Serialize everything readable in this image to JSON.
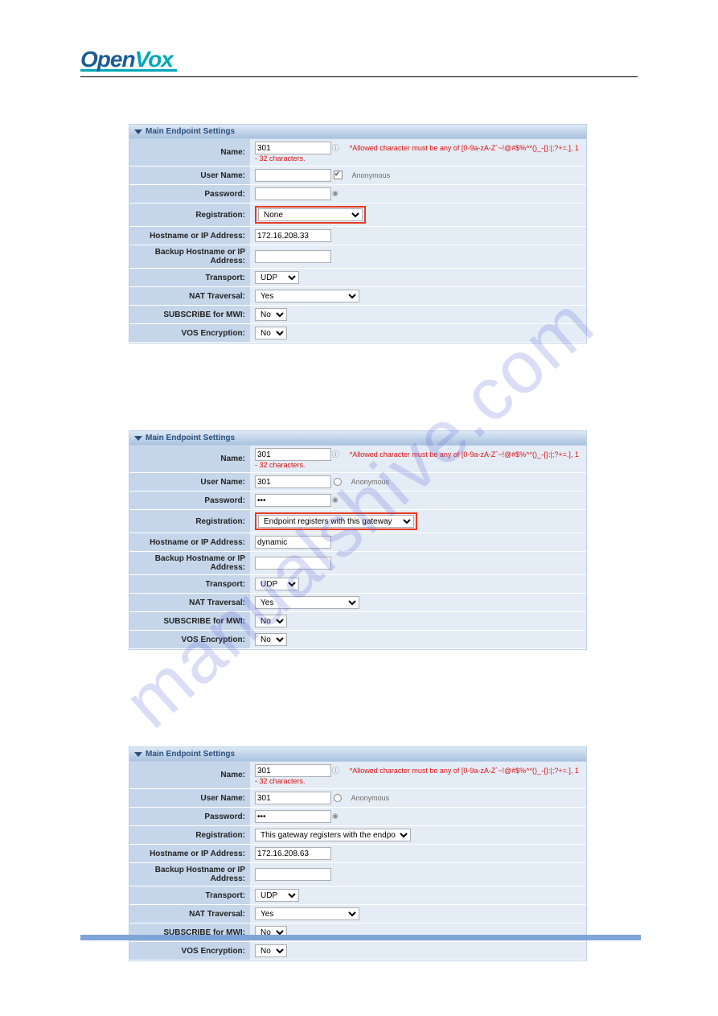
{
  "logo": {
    "left": "Open",
    "right": "Vox"
  },
  "watermark_text": "manualshive.com",
  "section_title": "Main Endpoint Settings",
  "labels": {
    "name": "Name:",
    "user_name": "User Name:",
    "password": "Password:",
    "registration": "Registration:",
    "hostname": "Hostname or IP Address:",
    "backup_hostname": "Backup Hostname or IP Address:",
    "transport": "Transport:",
    "nat": "NAT Traversal:",
    "subscribe_mwi": "SUBSCRIBE for MWI:",
    "vos_encryption": "VOS Encryption:"
  },
  "hint_text": "*Allowed character must be any of [0-9a-zA-Z`~!@#$%^*()_-{}:|;?+=.], 1 - 32 characters.",
  "anon_label": "Anonymous",
  "options": {
    "transport": [
      "UDP"
    ],
    "yesno": [
      "Yes",
      "No"
    ],
    "reg_none": [
      "None"
    ],
    "reg_endpoint": [
      "Endpoint registers with this gateway"
    ],
    "reg_gateway": [
      "This gateway registers with the endpoint"
    ]
  },
  "panels": [
    {
      "name": "301",
      "user_name": "",
      "anon_checked": true,
      "anon_type": "checkbox",
      "password": "",
      "registration": "None",
      "registration_boxed": true,
      "hostname": "172.16.208.33",
      "backup": "",
      "transport": "UDP",
      "nat": "Yes",
      "mwi": "No",
      "vos": "No"
    },
    {
      "name": "301",
      "user_name": "301",
      "anon_checked": false,
      "anon_type": "radio",
      "password": "•••",
      "registration": "Endpoint registers with this gateway",
      "registration_boxed": true,
      "hostname": "dynamic",
      "backup": "",
      "transport": "UDP",
      "nat": "Yes",
      "mwi": "No",
      "vos": "No"
    },
    {
      "name": "301",
      "user_name": "301",
      "anon_checked": false,
      "anon_type": "radio",
      "password": "•••",
      "registration": "This gateway registers with the endpoint",
      "registration_boxed": false,
      "hostname": "172.16.208.63",
      "backup": "",
      "transport": "UDP",
      "nat": "Yes",
      "mwi": "No",
      "vos": "No"
    }
  ]
}
